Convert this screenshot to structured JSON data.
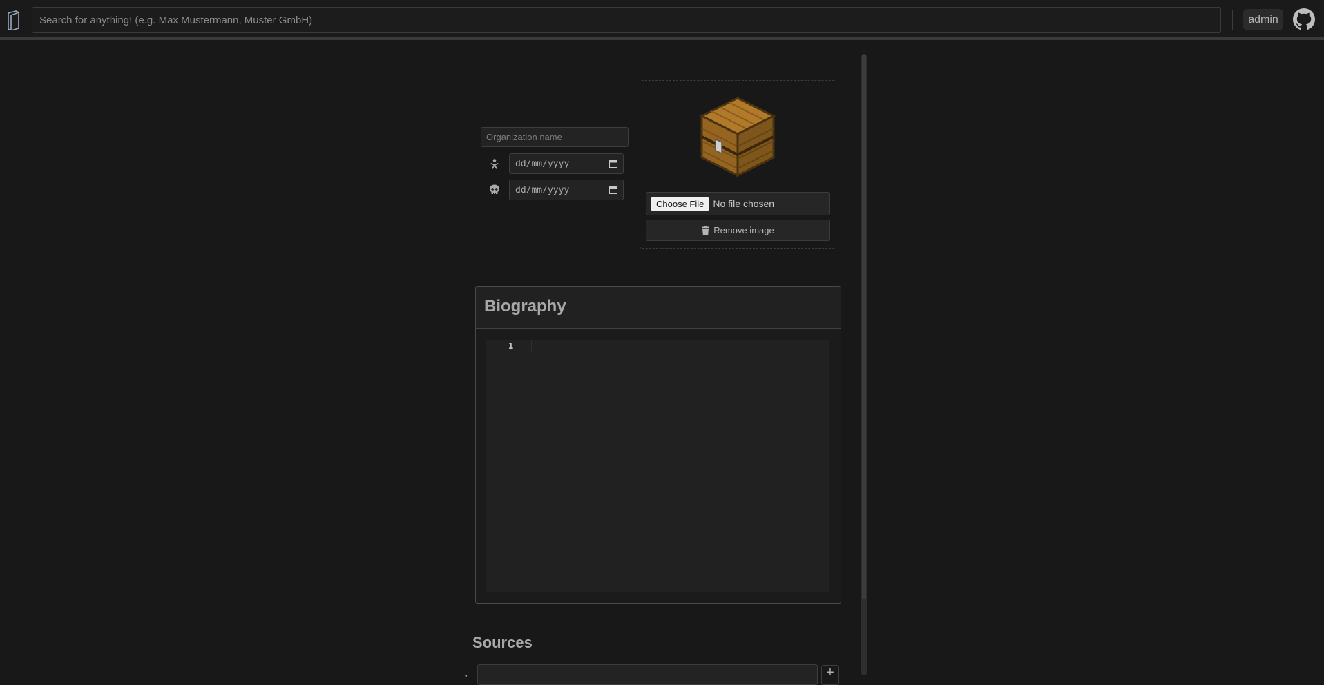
{
  "header": {
    "search_placeholder": "Search for anything! (e.g. Max Mustermann, Muster GmbH)",
    "user_label": "admin"
  },
  "form": {
    "name_placeholder": "Organization name",
    "founded_date_placeholder": "dd/mm/yyyy",
    "dissolved_date_placeholder": "dd/mm/yyyy",
    "choose_file_label": "Choose File",
    "no_file_text": "No file chosen",
    "remove_image_label": "Remove image"
  },
  "biography": {
    "title": "Biography",
    "line_number": "1"
  },
  "sources": {
    "title": "Sources",
    "add_label": "+"
  },
  "icons": {
    "logo": "book-icon",
    "github": "github-icon",
    "birth": "baby-icon",
    "death": "skull-icon",
    "trash": "trash-icon",
    "calendar": "calendar-icon"
  }
}
